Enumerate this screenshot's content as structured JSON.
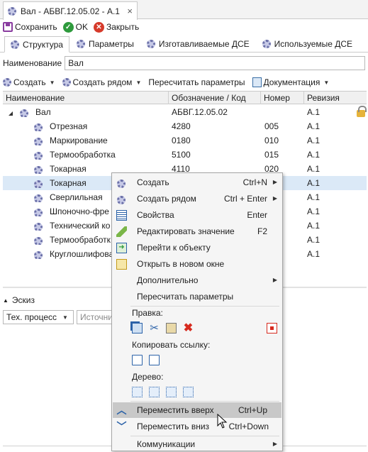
{
  "window": {
    "tab_title": "Вал - АБВГ.12.05.02 - А.1",
    "close_glyph": "×"
  },
  "toolbar": {
    "save": "Сохранить",
    "ok": "OK",
    "close": "Закрыть",
    "ok_glyph": "✓",
    "close_glyph": "✕"
  },
  "tabs": [
    {
      "label": "Структура",
      "active": true
    },
    {
      "label": "Параметры"
    },
    {
      "label": "Изготавливаемые ДСЕ"
    },
    {
      "label": "Используемые ДСЕ"
    }
  ],
  "name_field": {
    "label": "Наименование",
    "value": "Вал"
  },
  "actions": {
    "create": "Создать",
    "create_near": "Создать рядом",
    "recalc": "Пересчитать параметры",
    "docs": "Документация"
  },
  "grid": {
    "columns": [
      "Наименование",
      "Обозначение / Код",
      "Номер",
      "Ревизия"
    ],
    "root": {
      "name": "Вал",
      "code": "АБВГ.12.05.02",
      "num": "",
      "rev": "А.1"
    },
    "rows": [
      {
        "name": "Отрезная",
        "code": "4280",
        "num": "005",
        "rev": "А.1"
      },
      {
        "name": "Маркирование",
        "code": "0180",
        "num": "010",
        "rev": "А.1"
      },
      {
        "name": "Термообработка",
        "code": "5100",
        "num": "015",
        "rev": "А.1"
      },
      {
        "name": "Токарная",
        "code": "4110",
        "num": "020",
        "rev": "А.1"
      },
      {
        "name": "Токарная",
        "code": "",
        "num": "",
        "rev": "А.1"
      },
      {
        "name": "Сверлильная",
        "code": "",
        "num": "",
        "rev": "А.1"
      },
      {
        "name": "Шпоночно-фре",
        "code": "",
        "num": "",
        "rev": "А.1"
      },
      {
        "name": "Технический ко",
        "code": "",
        "num": "",
        "rev": "А.1"
      },
      {
        "name": "Термообработк",
        "code": "",
        "num": "",
        "rev": "А.1"
      },
      {
        "name": "Круглошлифова",
        "code": "",
        "num": "",
        "rev": "А.1"
      }
    ],
    "selected_row": 4
  },
  "sketch": {
    "title": "Эскиз",
    "process_combo": "Тех. процесс",
    "source_combo": "Источни"
  },
  "context_menu": {
    "items": [
      {
        "label": "Создать",
        "shortcut": "Ctrl+N",
        "submenu": true,
        "icon": "gear-icon"
      },
      {
        "label": "Создать рядом",
        "shortcut": "Ctrl + Enter",
        "submenu": true,
        "icon": "gear-icon"
      },
      {
        "label": "Свойства",
        "shortcut": "Enter",
        "icon": "properties-icon"
      },
      {
        "label": "Редактировать значение",
        "shortcut": "F2",
        "icon": "edit-icon"
      },
      {
        "label": "Перейти к объекту",
        "shortcut": "",
        "icon": "goto-icon"
      },
      {
        "label": "Открыть в новом окне",
        "shortcut": "",
        "icon": "new-window-icon"
      },
      {
        "label": "Дополнительно",
        "shortcut": "",
        "submenu": true
      },
      {
        "label": "Пересчитать параметры",
        "shortcut": ""
      }
    ],
    "edit_group": "Правка:",
    "copy_link_group": "Копировать ссылку:",
    "tree_group": "Дерево:",
    "move_up": {
      "label": "Переместить вверх",
      "shortcut": "Ctrl+Up"
    },
    "move_down": {
      "label": "Переместить вниз",
      "shortcut": "Ctrl+Down"
    },
    "communications": "Коммуникации"
  },
  "colors": {
    "accent": "#2b62a8",
    "selection": "#dbe9f7",
    "menu_highlight": "#c8c8c8",
    "delete": "#d62a1e",
    "ok": "#2e9a3c"
  }
}
